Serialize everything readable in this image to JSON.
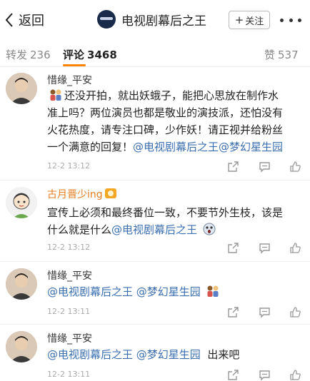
{
  "topbar": {
    "back_label": "返回",
    "account_name": "电视剧幕后之王",
    "follow_label": "关注"
  },
  "tabs": [
    {
      "label": "转发",
      "count": "236"
    },
    {
      "label": "评论",
      "count": "3468"
    },
    {
      "label": "赞",
      "count": "537"
    }
  ],
  "comments": [
    {
      "user": "惜缘_平安",
      "lines": [
        {
          "text": "还没开拍，就出妖蛾子，能把心思放在制作水",
          "emoji_before": "couple-emoji"
        },
        {
          "text": "准上吗？两位演员也都是敬业的演技派，还怕没有"
        },
        {
          "text": "火花热度，请专注口碑，少作妖！请正视并给粉丝"
        },
        {
          "text": "一个满意的回复！",
          "mentions": [
            "@电视剧幕后之王",
            "@梦幻星生园"
          ]
        }
      ],
      "time": "12-2 13:12"
    },
    {
      "user": "古月晋少ing",
      "lines": [
        {
          "text": "宣传上必须和最终番位一致，不要节外生枝，该是"
        },
        {
          "text": "什么就是什么",
          "mentions": [
            "@电视剧幕后之王"
          ],
          "emoji_after": "shocked-face-emoji"
        }
      ],
      "time": "12-2 13:12"
    },
    {
      "user": "惜缘_平安",
      "lines": [
        {
          "text": "",
          "mentions": [
            "@电视剧幕后之王",
            "@梦幻星生园"
          ],
          "emoji_after": "couple-emoji"
        }
      ],
      "time": "12-2 13:11"
    },
    {
      "user": "惜缘_平安",
      "lines": [
        {
          "text": "",
          "mentions": [
            "@电视剧幕后之王",
            "@梦幻星生园"
          ],
          "tail": "出来吧"
        }
      ],
      "time": "12-2 13:11"
    }
  ],
  "colors": {
    "accent": "#ff8200",
    "mention": "#3b6fb0",
    "username_vip": "#e67e22"
  },
  "icons": [
    "back-chevron-icon",
    "follow-plus-icon",
    "more-dots-icon",
    "share-icon",
    "comment-icon",
    "like-icon"
  ]
}
